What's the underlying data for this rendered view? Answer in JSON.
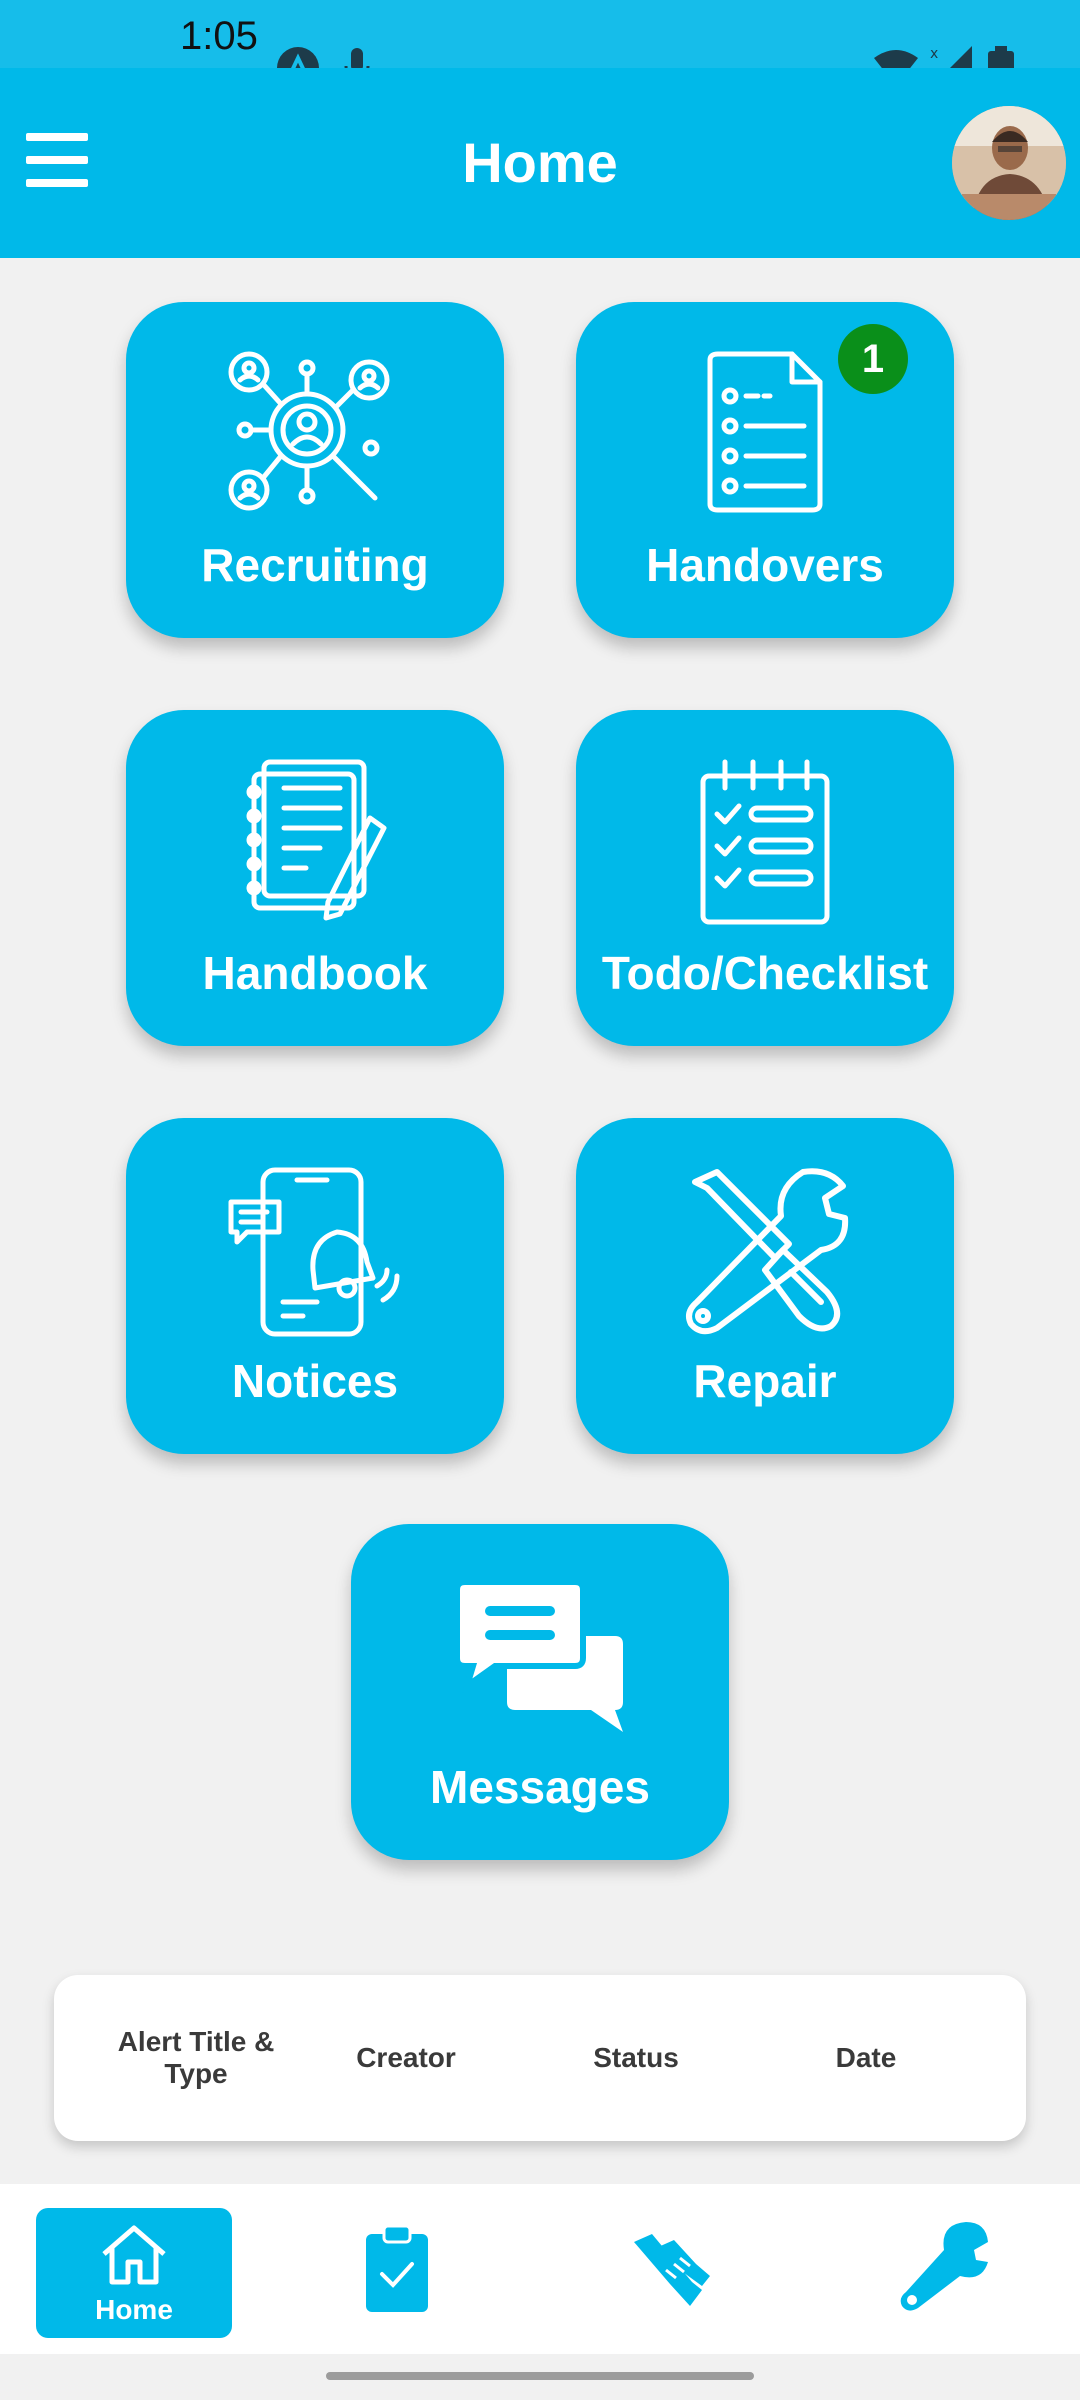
{
  "status_bar": {
    "time": "1:05",
    "icons": [
      "app-notification-icon",
      "mic-icon",
      "wifi-icon",
      "signal-icon",
      "battery-icon"
    ]
  },
  "app_bar": {
    "title": "Home",
    "menu_icon": "hamburger-menu-icon",
    "avatar": "profile-avatar"
  },
  "tiles": [
    {
      "label": "Recruiting",
      "icon": "recruiting-search-people-icon"
    },
    {
      "label": "Handovers",
      "icon": "document-list-icon",
      "badge": "1"
    },
    {
      "label": "Handbook",
      "icon": "notebook-pen-icon"
    },
    {
      "label": "Todo/Checklist",
      "icon": "checklist-notepad-icon"
    },
    {
      "label": "Notices",
      "icon": "phone-notification-bell-icon"
    },
    {
      "label": "Repair",
      "icon": "wrench-screwdriver-icon"
    },
    {
      "label": "Messages",
      "icon": "chat-bubbles-icon"
    }
  ],
  "alerts_table": {
    "columns": [
      "Alert Title & Type",
      "Creator",
      "Status",
      "Date"
    ]
  },
  "bottom_nav": {
    "items": [
      {
        "label": "Home",
        "icon": "home-icon",
        "active": true
      },
      {
        "label": "",
        "icon": "clipboard-check-icon"
      },
      {
        "label": "",
        "icon": "handshake-icon"
      },
      {
        "label": "",
        "icon": "wrench-icon"
      }
    ]
  },
  "colors": {
    "primary": "#00b9e9",
    "badge": "#0a8f1a",
    "background": "#f1f1f1"
  }
}
